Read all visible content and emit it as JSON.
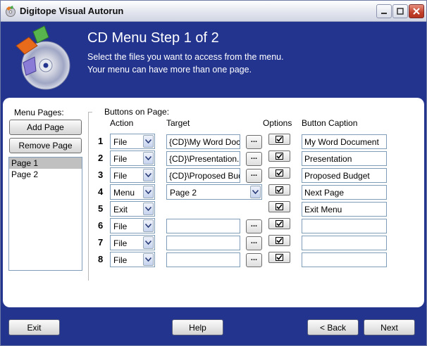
{
  "window": {
    "title": "Digitope Visual Autorun"
  },
  "header": {
    "heading": "CD Menu Step 1 of 2",
    "line1": "Select the files you want to access from the menu.",
    "line2": "Your menu can have more than one page."
  },
  "pages": {
    "label": "Menu Pages:",
    "add_button": "Add Page",
    "remove_button": "Remove Page",
    "items": [
      "Page 1",
      "Page 2"
    ],
    "selected_index": 0
  },
  "buttons_section": {
    "label": "Buttons on Page:",
    "col_action": "Action",
    "col_target": "Target",
    "col_options": "Options",
    "col_caption": "Button Caption",
    "browse_label": "...",
    "rows": [
      {
        "num": "1",
        "action": "File",
        "target": "{CD}\\My Word Document.doc",
        "caption": "My Word Document",
        "has_browse": true,
        "has_option": true
      },
      {
        "num": "2",
        "action": "File",
        "target": "{CD}\\Presentation.ppt",
        "caption": "Presentation",
        "has_browse": true,
        "has_option": true
      },
      {
        "num": "3",
        "action": "File",
        "target": "{CD}\\Proposed Budget.xls",
        "caption": "Proposed Budget",
        "has_browse": true,
        "has_option": true
      },
      {
        "num": "4",
        "action": "Menu",
        "target": "Page 2",
        "caption": "Next Page",
        "has_browse": false,
        "has_option": true
      },
      {
        "num": "5",
        "action": "Exit",
        "target": "",
        "caption": "Exit Menu",
        "has_browse": false,
        "has_option": true
      },
      {
        "num": "6",
        "action": "File",
        "target": "",
        "caption": "",
        "has_browse": true,
        "has_option": true
      },
      {
        "num": "7",
        "action": "File",
        "target": "",
        "caption": "",
        "has_browse": true,
        "has_option": true
      },
      {
        "num": "8",
        "action": "File",
        "target": "",
        "caption": "",
        "has_browse": true,
        "has_option": true
      }
    ]
  },
  "footer": {
    "exit": "Exit",
    "help": "Help",
    "back": "< Back",
    "next": "Next"
  },
  "colors": {
    "background": "#23348f",
    "panel": "#ffffff"
  }
}
